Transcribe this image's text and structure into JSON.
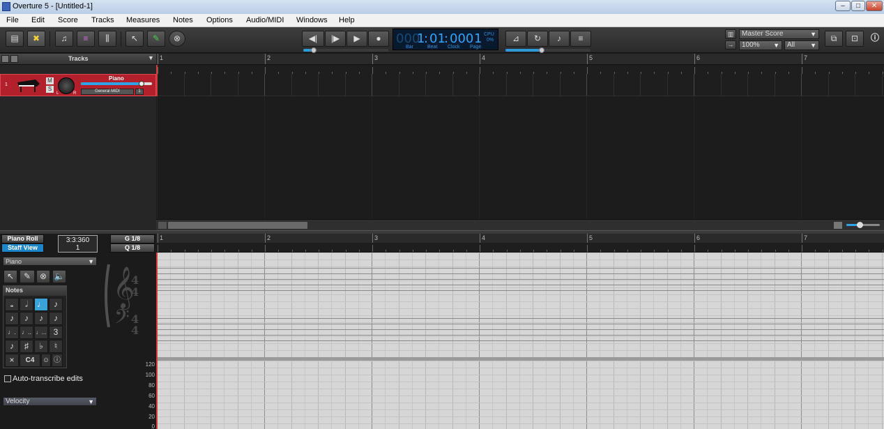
{
  "window": {
    "title": "Overture 5 - [Untitled-1]"
  },
  "menu": [
    "File",
    "Edit",
    "Score",
    "Tracks",
    "Measures",
    "Notes",
    "Options",
    "Audio/MIDI",
    "Windows",
    "Help"
  ],
  "counter": {
    "bar_dim": "000",
    "bar": "1",
    "beat": "01",
    "clock": "000",
    "page": "1",
    "cpu_label": "CPU",
    "cpu_value": "0%",
    "labels": [
      "Bar",
      "Beat",
      "Clock",
      "Page"
    ]
  },
  "score_select": {
    "value": "Master Score"
  },
  "zoom": {
    "value": "100%"
  },
  "view_filter": {
    "value": "All"
  },
  "tracks_panel": {
    "header": "Tracks",
    "track": {
      "number": "1",
      "name": "Piano",
      "mute": "M",
      "solo": "S",
      "device": "General MIDI",
      "channel": "1",
      "pan_l": "L",
      "pan_r": "R",
      "volume": 0.85
    }
  },
  "ruler": {
    "measures": [
      "1",
      "2",
      "3",
      "4",
      "5",
      "6",
      "7"
    ]
  },
  "lower": {
    "piano_roll_label": "Piano Roll",
    "staff_view_label": "Staff View",
    "position_top": "3:3:360",
    "position_bottom": "1",
    "grid_label": "G 1/8",
    "quantize_label": "Q 1/8",
    "instrument": "Piano",
    "notes_header": "Notes",
    "note_row1": [
      "𝅝",
      "𝅗𝅥",
      "♩",
      "♪"
    ],
    "note_row2": [
      "♪",
      "♪",
      "♪",
      "♪"
    ],
    "note_row3": [
      "♩.",
      "♩..",
      "♩...",
      "3"
    ],
    "note_row4": [
      "♪",
      "♯",
      "♭",
      "♮"
    ],
    "note_row5": [
      "×",
      "C4",
      "",
      ""
    ],
    "auto_transcribe": "Auto-transcribe edits",
    "controller": "Velocity",
    "velocity_ticks": [
      "120",
      "100",
      "80",
      "60",
      "40",
      "20",
      "0"
    ]
  }
}
